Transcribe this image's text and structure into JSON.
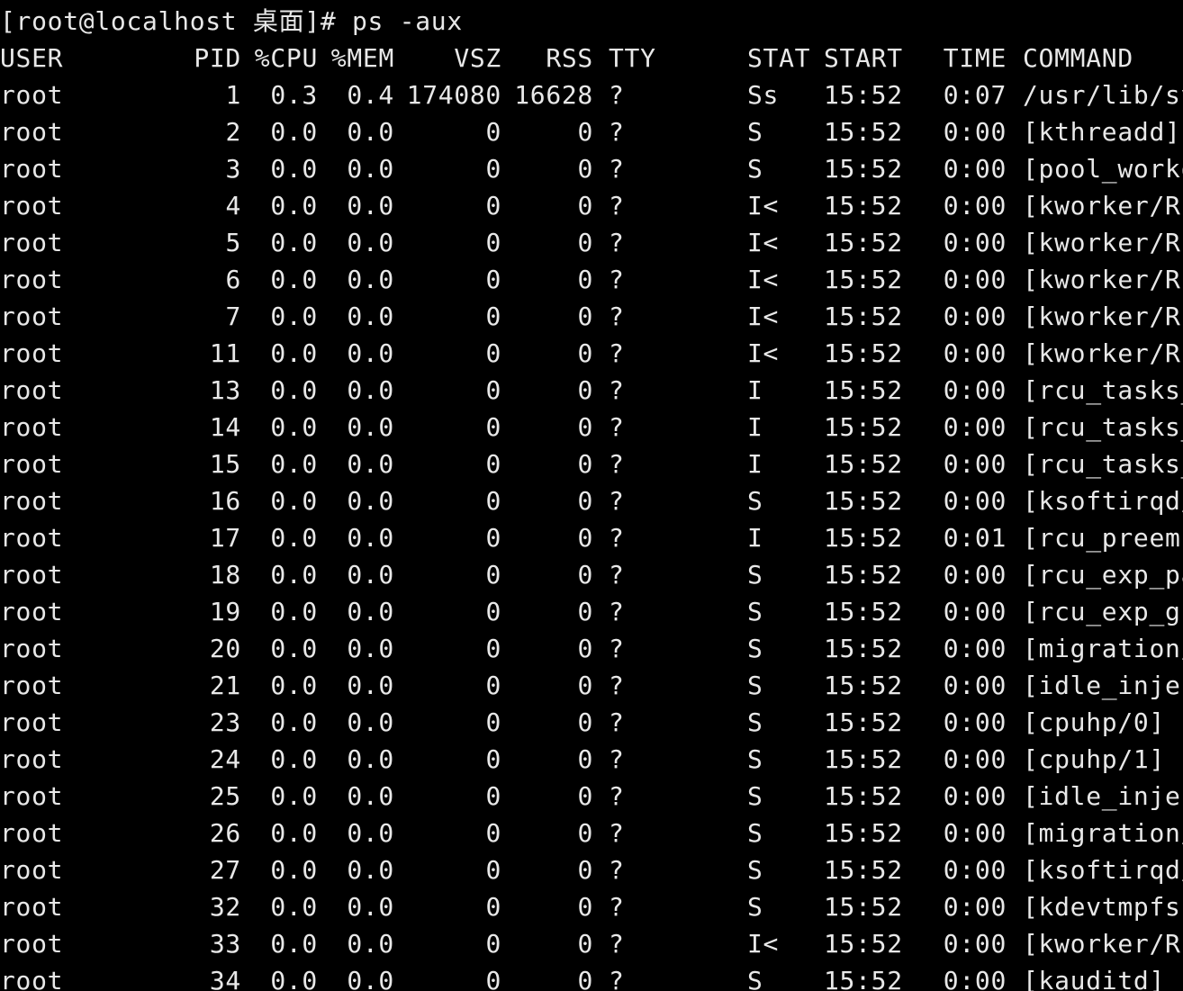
{
  "terminal": {
    "prompt": "[root@localhost 桌面]# ps -aux",
    "colors": {
      "background": "#000000",
      "foreground": "#e8e8e8"
    },
    "headers": [
      "USER",
      "PID",
      "%CPU",
      "%MEM",
      "VSZ",
      "RSS",
      "TTY",
      "STAT",
      "START",
      "TIME",
      "COMMAND"
    ],
    "rows": [
      [
        "root",
        "1",
        "0.3",
        "0.4",
        "174080",
        "16628",
        "?",
        "Ss",
        "15:52",
        "0:07",
        "/usr/lib/sy"
      ],
      [
        "root",
        "2",
        "0.0",
        "0.0",
        "0",
        "0",
        "?",
        "S",
        "15:52",
        "0:00",
        "[kthreadd]"
      ],
      [
        "root",
        "3",
        "0.0",
        "0.0",
        "0",
        "0",
        "?",
        "S",
        "15:52",
        "0:00",
        "[pool_worko"
      ],
      [
        "root",
        "4",
        "0.0",
        "0.0",
        "0",
        "0",
        "?",
        "I<",
        "15:52",
        "0:00",
        "[kworker/R-"
      ],
      [
        "root",
        "5",
        "0.0",
        "0.0",
        "0",
        "0",
        "?",
        "I<",
        "15:52",
        "0:00",
        "[kworker/R-"
      ],
      [
        "root",
        "6",
        "0.0",
        "0.0",
        "0",
        "0",
        "?",
        "I<",
        "15:52",
        "0:00",
        "[kworker/R-"
      ],
      [
        "root",
        "7",
        "0.0",
        "0.0",
        "0",
        "0",
        "?",
        "I<",
        "15:52",
        "0:00",
        "[kworker/R-"
      ],
      [
        "root",
        "11",
        "0.0",
        "0.0",
        "0",
        "0",
        "?",
        "I<",
        "15:52",
        "0:00",
        "[kworker/R-"
      ],
      [
        "root",
        "13",
        "0.0",
        "0.0",
        "0",
        "0",
        "?",
        "I",
        "15:52",
        "0:00",
        "[rcu_tasks_"
      ],
      [
        "root",
        "14",
        "0.0",
        "0.0",
        "0",
        "0",
        "?",
        "I",
        "15:52",
        "0:00",
        "[rcu_tasks_"
      ],
      [
        "root",
        "15",
        "0.0",
        "0.0",
        "0",
        "0",
        "?",
        "I",
        "15:52",
        "0:00",
        "[rcu_tasks_"
      ],
      [
        "root",
        "16",
        "0.0",
        "0.0",
        "0",
        "0",
        "?",
        "S",
        "15:52",
        "0:00",
        "[ksoftirqd/"
      ],
      [
        "root",
        "17",
        "0.0",
        "0.0",
        "0",
        "0",
        "?",
        "I",
        "15:52",
        "0:01",
        "[rcu_preemp"
      ],
      [
        "root",
        "18",
        "0.0",
        "0.0",
        "0",
        "0",
        "?",
        "S",
        "15:52",
        "0:00",
        "[rcu_exp_pa"
      ],
      [
        "root",
        "19",
        "0.0",
        "0.0",
        "0",
        "0",
        "?",
        "S",
        "15:52",
        "0:00",
        "[rcu_exp_gp"
      ],
      [
        "root",
        "20",
        "0.0",
        "0.0",
        "0",
        "0",
        "?",
        "S",
        "15:52",
        "0:00",
        "[migration/"
      ],
      [
        "root",
        "21",
        "0.0",
        "0.0",
        "0",
        "0",
        "?",
        "S",
        "15:52",
        "0:00",
        "[idle_injec"
      ],
      [
        "root",
        "23",
        "0.0",
        "0.0",
        "0",
        "0",
        "?",
        "S",
        "15:52",
        "0:00",
        "[cpuhp/0]"
      ],
      [
        "root",
        "24",
        "0.0",
        "0.0",
        "0",
        "0",
        "?",
        "S",
        "15:52",
        "0:00",
        "[cpuhp/1]"
      ],
      [
        "root",
        "25",
        "0.0",
        "0.0",
        "0",
        "0",
        "?",
        "S",
        "15:52",
        "0:00",
        "[idle_injec"
      ],
      [
        "root",
        "26",
        "0.0",
        "0.0",
        "0",
        "0",
        "?",
        "S",
        "15:52",
        "0:00",
        "[migration/"
      ],
      [
        "root",
        "27",
        "0.0",
        "0.0",
        "0",
        "0",
        "?",
        "S",
        "15:52",
        "0:00",
        "[ksoftirqd/"
      ],
      [
        "root",
        "32",
        "0.0",
        "0.0",
        "0",
        "0",
        "?",
        "S",
        "15:52",
        "0:00",
        "[kdevtmpfs]"
      ],
      [
        "root",
        "33",
        "0.0",
        "0.0",
        "0",
        "0",
        "?",
        "I<",
        "15:52",
        "0:00",
        "[kworker/R-"
      ],
      [
        "root",
        "34",
        "0.0",
        "0.0",
        "0",
        "0",
        "?",
        "S",
        "15:52",
        "0:00",
        "[kauditd]"
      ]
    ]
  }
}
